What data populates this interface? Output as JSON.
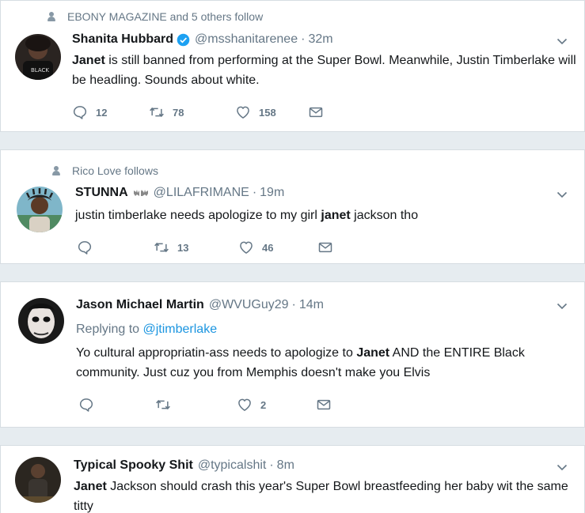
{
  "tweets": [
    {
      "social": "EBONY MAGAZINE and 5 others follow",
      "name": "Shanita Hubbard",
      "handle": "@msshanitarenee",
      "time": "32m",
      "text_html": "<b>Janet</b> is still banned from performing at the Super Bowl. Meanwhile, Justin Timberlake will be headling. Sounds about white.",
      "replies": "12",
      "retweets": "78",
      "likes": "158"
    },
    {
      "social": "Rico Love follows",
      "name": "STUNNA",
      "handle": "@LILAFRIMANE",
      "time": "19m",
      "text_html": "justin timberlake needs apologize to my girl <b>janet</b> jackson tho",
      "replies": "",
      "retweets": "13",
      "likes": "46"
    },
    {
      "name": "Jason Michael Martin",
      "handle": "@WVUGuy29",
      "time": "14m",
      "replying_prefix": "Replying to",
      "replying_to": "@jtimberlake",
      "text_html": "Yo cultural appropriatin-ass needs to apologize to <b>Janet</b> AND the ENTIRE Black community. Just cuz you from Memphis doesn't make you Elvis",
      "replies": "",
      "retweets": "",
      "likes": "2"
    },
    {
      "name": "Typical Spooky Shit",
      "handle": "@typicalshit",
      "time": "8m",
      "text_html": "<b>Janet</b> Jackson should crash this year's Super Bowl breastfeeding her baby wit the same titty"
    }
  ],
  "separator": "·",
  "icons": {
    "reply": "reply-icon",
    "retweet": "retweet-icon",
    "like": "heart-icon",
    "dm": "envelope-icon",
    "more": "chevron-down-icon",
    "verified": "verified-badge-icon",
    "social": "person-icon"
  },
  "colors": {
    "background": "#e6ecf0",
    "text": "#14171a",
    "muted": "#657786",
    "link": "#1b95e0",
    "verified": "#1da1f2"
  }
}
